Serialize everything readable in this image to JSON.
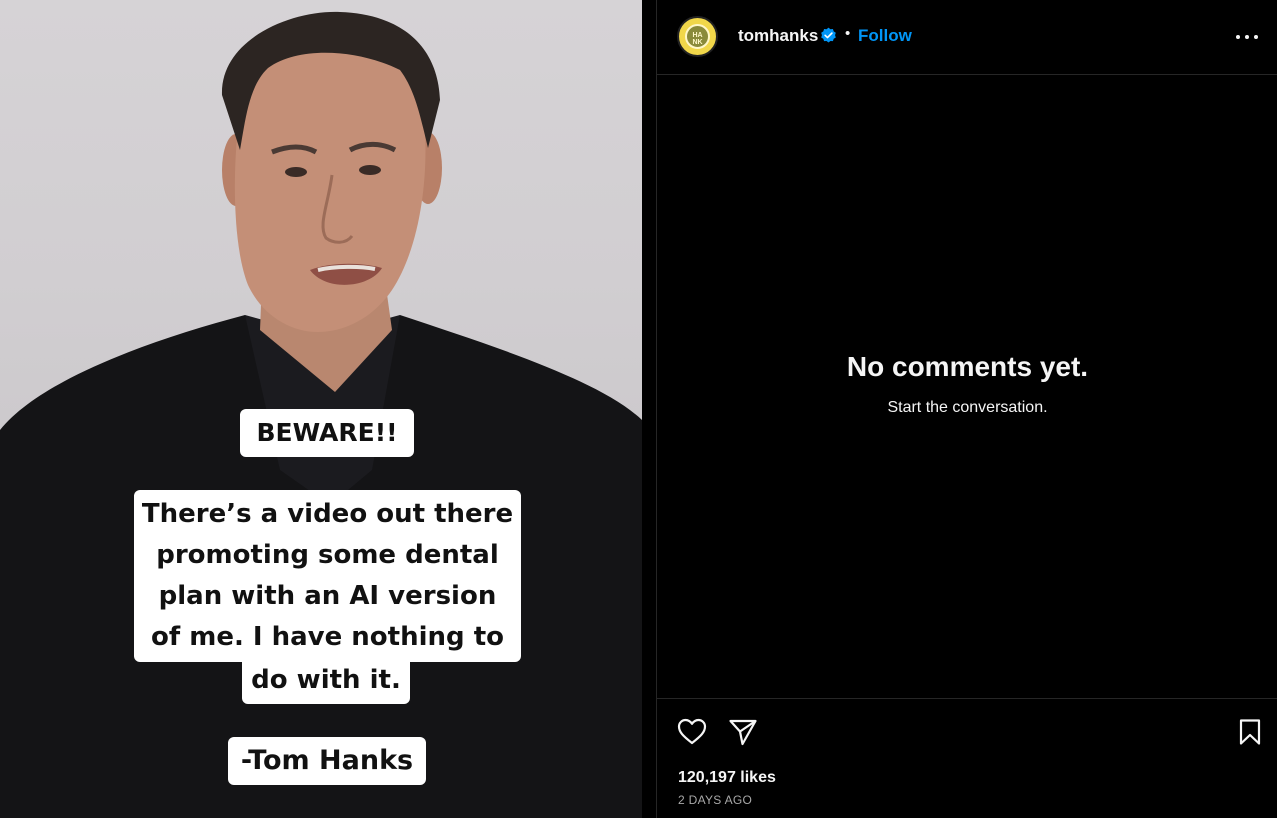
{
  "media": {
    "caption_beware": "BEWARE!!",
    "caption_main": "There’s a video out there\npromoting some dental\nplan with an AI version\nof me.  I have nothing to",
    "caption_tail": "do with it.",
    "caption_signature": "-Tom Hanks"
  },
  "header": {
    "avatar_text": "HA\nNK",
    "username": "tomhanks",
    "verified_icon": "verified-badge-icon",
    "separator": "•",
    "follow_label": "Follow",
    "more_icon": "more-options-icon"
  },
  "comments": {
    "empty_title": "No comments yet.",
    "empty_subtitle": "Start the conversation."
  },
  "footer": {
    "icons": [
      "heart-icon",
      "share-icon",
      "bookmark-icon"
    ],
    "likes": "120,197 likes",
    "timestamp": "2 DAYS AGO"
  },
  "colors": {
    "accent": "#0095f6",
    "background": "#000000",
    "divider": "#262626",
    "muted_text": "#a8a8a8"
  }
}
